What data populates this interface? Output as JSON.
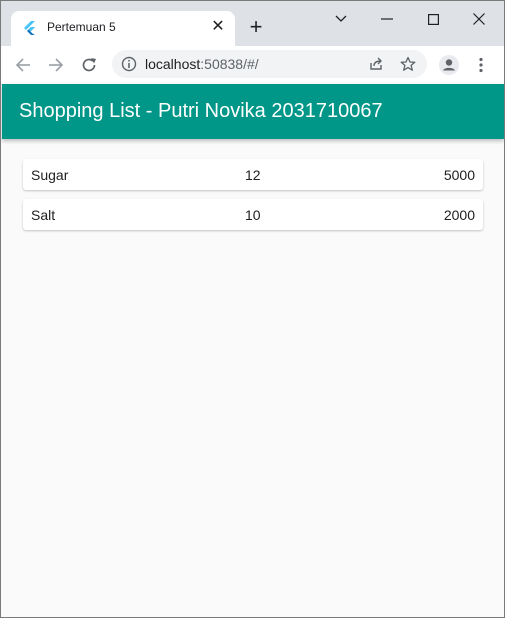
{
  "browser": {
    "tab_title": "Pertemuan 5",
    "url_host": "localhost",
    "url_rest": ":50838/#/"
  },
  "app": {
    "title": "Shopping List - Putri Novika 2031710067",
    "primary_color": "#009688"
  },
  "items": [
    {
      "name": "Sugar",
      "quantity": "12",
      "price": "5000"
    },
    {
      "name": "Salt",
      "quantity": "10",
      "price": "2000"
    }
  ]
}
